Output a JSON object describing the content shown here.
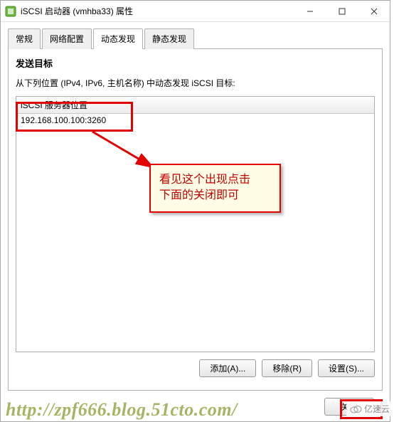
{
  "window": {
    "title": "iSCSI 启动器 (vmhba33) 属性"
  },
  "tabs": {
    "t0": "常规",
    "t1": "网络配置",
    "t2": "动态发现",
    "t3": "静态发现"
  },
  "section": {
    "title": "发送目标",
    "desc": "从下列位置 (IPv4, IPv6, 主机名称) 中动态发现 iSCSI 目标:"
  },
  "table": {
    "header": "iSCSI 服务器位置",
    "rows": [
      "192.168.100.100:3260"
    ]
  },
  "callout": {
    "line1": "看见这个出现点击",
    "line2": "下面的关闭即可"
  },
  "buttons": {
    "add": "添加(A)...",
    "remove": "移除(R)",
    "settings": "设置(S)...",
    "close": "关闭"
  },
  "watermark": "http://zpf666.blog.51cto.com/",
  "logo": "亿速云"
}
